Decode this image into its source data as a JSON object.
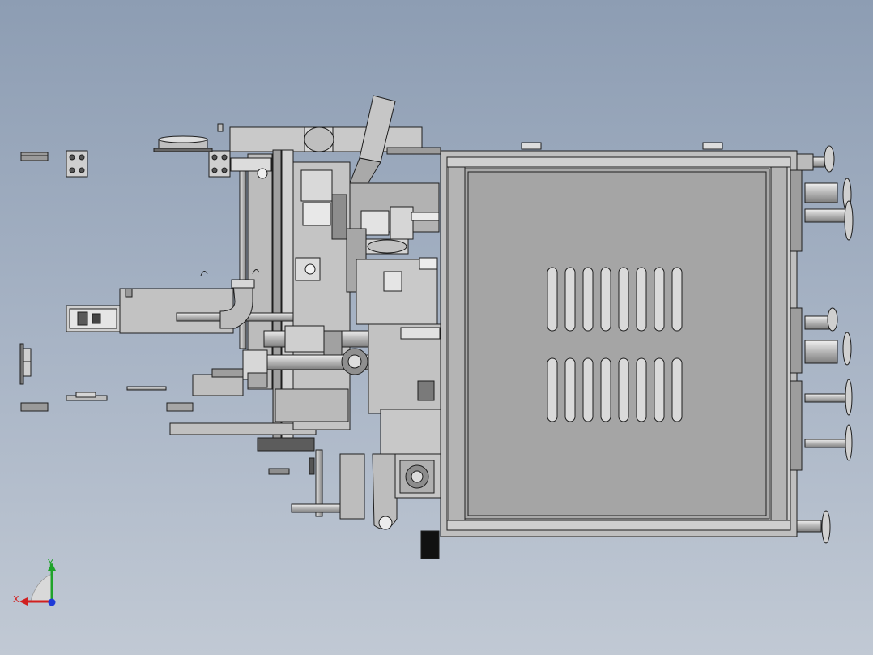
{
  "viewport": {
    "background_top": "#8d9db3",
    "background_bottom": "#c1c9d4"
  },
  "triad": {
    "x_label": "X",
    "y_label": "Y",
    "x_color": "#d12020",
    "y_color": "#1fa32a",
    "z_color": "#1e3ad8"
  },
  "colors": {
    "part_fill": "#c8c8c8",
    "part_dark": "#8e8e8e",
    "part_light": "#e2e2e2",
    "edge": "#1e1e1e",
    "panel": "#a9a9a9"
  }
}
